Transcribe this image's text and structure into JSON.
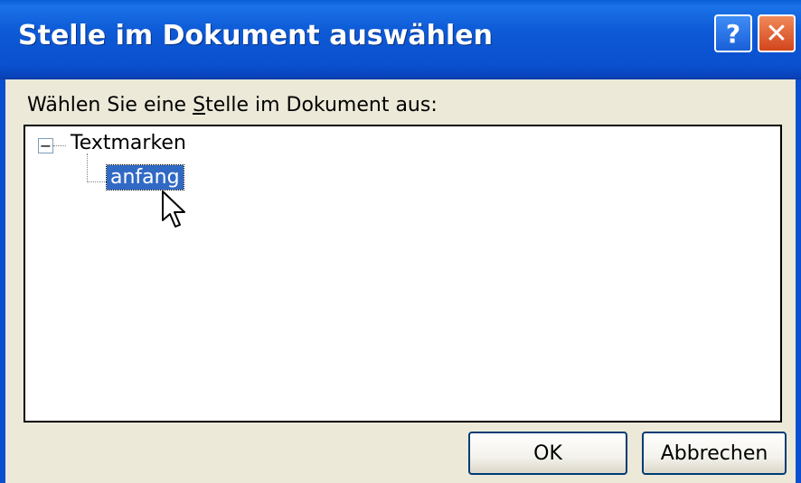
{
  "window": {
    "title": "Stelle im Dokument auswählen",
    "help_glyph": "?",
    "close_glyph": "✕"
  },
  "prompt": {
    "before": "Wählen Sie eine ",
    "accel": "S",
    "after": "telle im Dokument aus:"
  },
  "tree": {
    "root": {
      "expander": "−",
      "label": "Textmarken"
    },
    "children": [
      {
        "label": "anfang",
        "selected": true
      }
    ]
  },
  "buttons": {
    "ok": "OK",
    "cancel": "Abbrechen"
  },
  "colors": {
    "titlebar": "#0a4fcf",
    "selection": "#316ac5",
    "dialog_bg": "#ece9d8",
    "close_button": "#d2451c"
  },
  "icons": [
    "help-icon",
    "close-icon",
    "tree-collapse-icon",
    "mouse-cursor-icon"
  ]
}
